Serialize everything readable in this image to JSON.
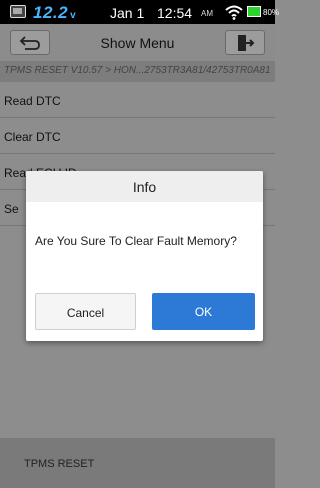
{
  "status_bar": {
    "voltage": "12.2",
    "voltage_unit": "v",
    "date": "Jan 1",
    "time": "12:54",
    "ampm": "AM",
    "battery": "80%",
    "voltage_color": "#4ab3ff",
    "battery_color": "#2ed22e"
  },
  "toolbar": {
    "title": "Show Menu",
    "back_icon": "back-arrow-icon",
    "exit_icon": "exit-icon"
  },
  "breadcrumb": "TPMS RESET V10.57 > HON...2753TR3A81/42753TR0A81",
  "menu": {
    "items": [
      {
        "label": "Read DTC"
      },
      {
        "label": "Clear DTC"
      },
      {
        "label": "Read ECU ID"
      },
      {
        "label": "Se"
      }
    ]
  },
  "footer": {
    "label": "TPMS RESET"
  },
  "dialog": {
    "title": "Info",
    "message": "Are You Sure To Clear Fault Memory?",
    "cancel_label": "Cancel",
    "ok_label": "OK",
    "ok_color": "#2d7ad6"
  }
}
